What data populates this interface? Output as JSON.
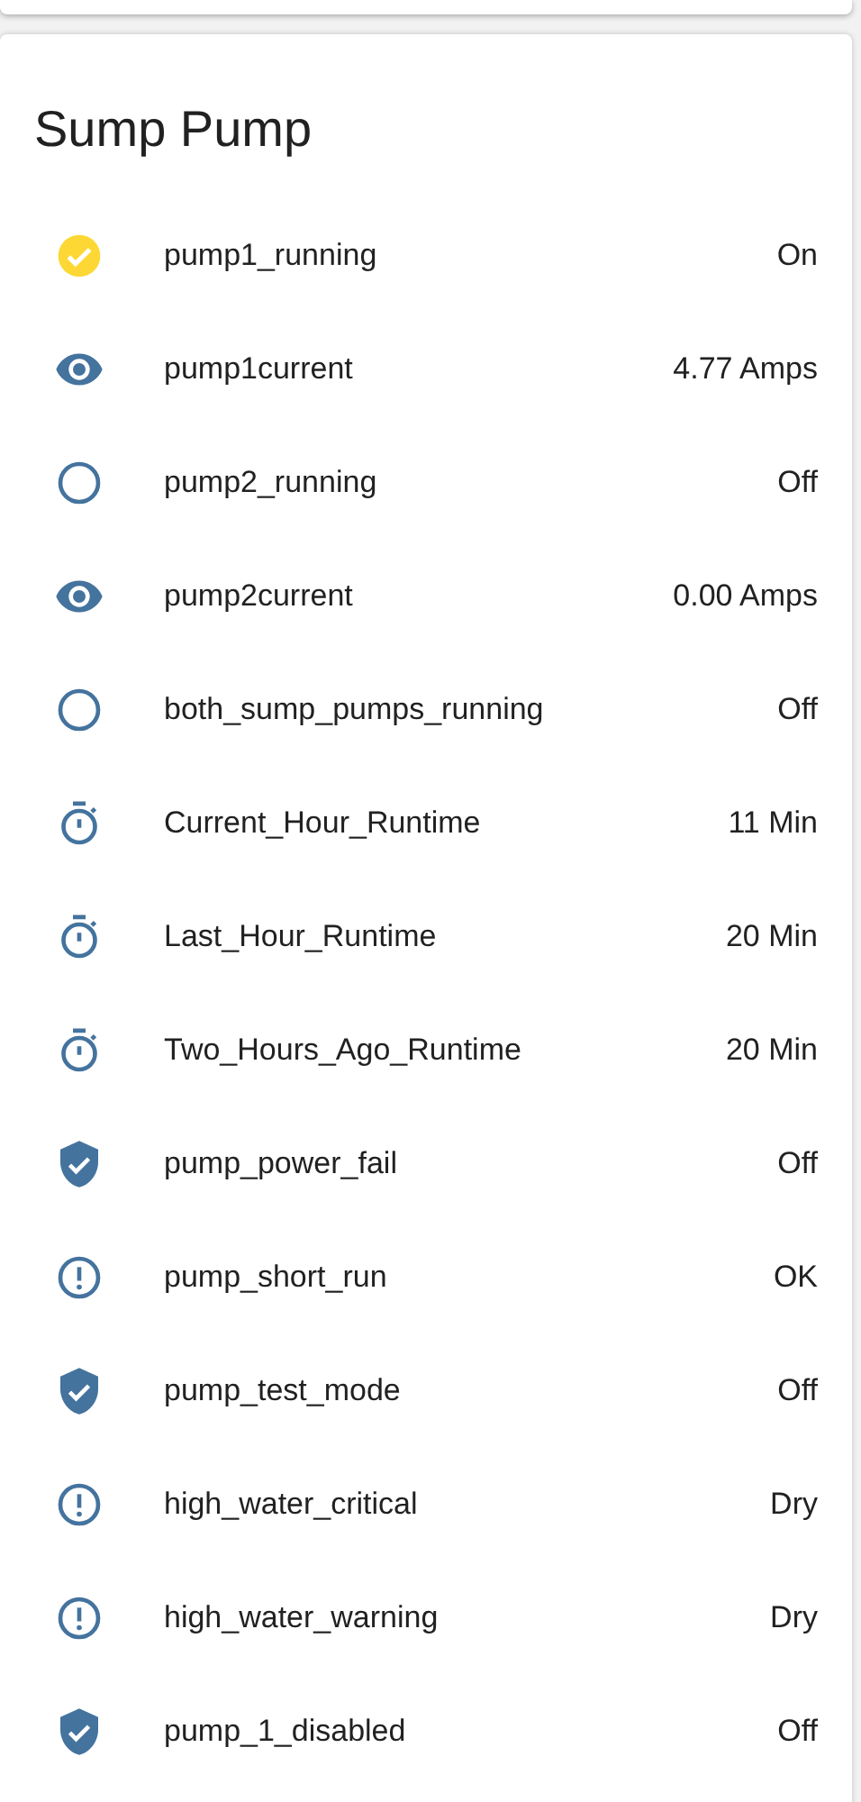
{
  "card": {
    "title": "Sump Pump",
    "entities": [
      {
        "kind": "binary",
        "on": true,
        "name": "pump1_running",
        "state": "On"
      },
      {
        "kind": "sensor",
        "name": "pump1current",
        "state": "4.77 Amps"
      },
      {
        "kind": "binary",
        "on": false,
        "name": "pump2_running",
        "state": "Off"
      },
      {
        "kind": "sensor",
        "name": "pump2current",
        "state": "0.00 Amps"
      },
      {
        "kind": "binary",
        "on": false,
        "name": "both_sump_pumps_running",
        "state": "Off"
      },
      {
        "kind": "timer",
        "name": "Current_Hour_Runtime",
        "state": "11 Min"
      },
      {
        "kind": "timer",
        "name": "Last_Hour_Runtime",
        "state": "20 Min"
      },
      {
        "kind": "timer",
        "name": "Two_Hours_Ago_Runtime",
        "state": "20 Min"
      },
      {
        "kind": "safety",
        "name": "pump_power_fail",
        "state": "Off"
      },
      {
        "kind": "alert",
        "name": "pump_short_run",
        "state": "OK"
      },
      {
        "kind": "safety",
        "name": "pump_test_mode",
        "state": "Off"
      },
      {
        "kind": "alert",
        "name": "high_water_critical",
        "state": "Dry"
      },
      {
        "kind": "alert",
        "name": "high_water_warning",
        "state": "Dry"
      },
      {
        "kind": "safety",
        "name": "pump_1_disabled",
        "state": "Off"
      }
    ]
  }
}
